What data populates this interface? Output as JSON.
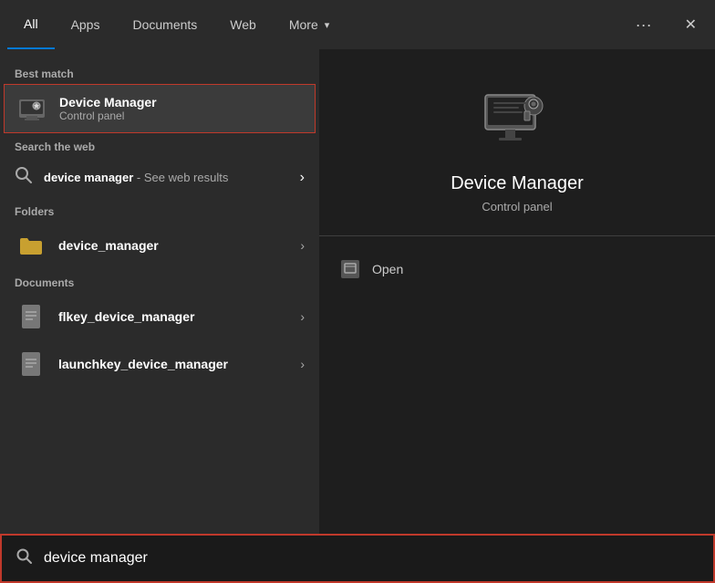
{
  "topNav": {
    "tabs": [
      {
        "id": "all",
        "label": "All",
        "active": true
      },
      {
        "id": "apps",
        "label": "Apps",
        "active": false
      },
      {
        "id": "documents",
        "label": "Documents",
        "active": false
      },
      {
        "id": "web",
        "label": "Web",
        "active": false
      },
      {
        "id": "more",
        "label": "More",
        "active": false
      }
    ],
    "moreArrow": "▾",
    "dotsLabel": "···",
    "closeLabel": "✕"
  },
  "leftPanel": {
    "bestMatchLabel": "Best match",
    "bestMatch": {
      "title": "Device Manager",
      "subtitle": "Control panel"
    },
    "searchWebLabel": "Search the web",
    "searchWebItem": {
      "query": "device manager",
      "suffix": " - See web results"
    },
    "foldersLabel": "Folders",
    "folders": [
      {
        "name": "device_manager"
      }
    ],
    "documentsLabel": "Documents",
    "documents": [
      {
        "name": "flkey_device_manager"
      },
      {
        "name": "launchkey_device_manager"
      }
    ]
  },
  "rightPanel": {
    "title": "Device Manager",
    "subtitle": "Control panel",
    "openLabel": "Open"
  },
  "searchBar": {
    "value": "device manager",
    "placeholder": "Search"
  }
}
